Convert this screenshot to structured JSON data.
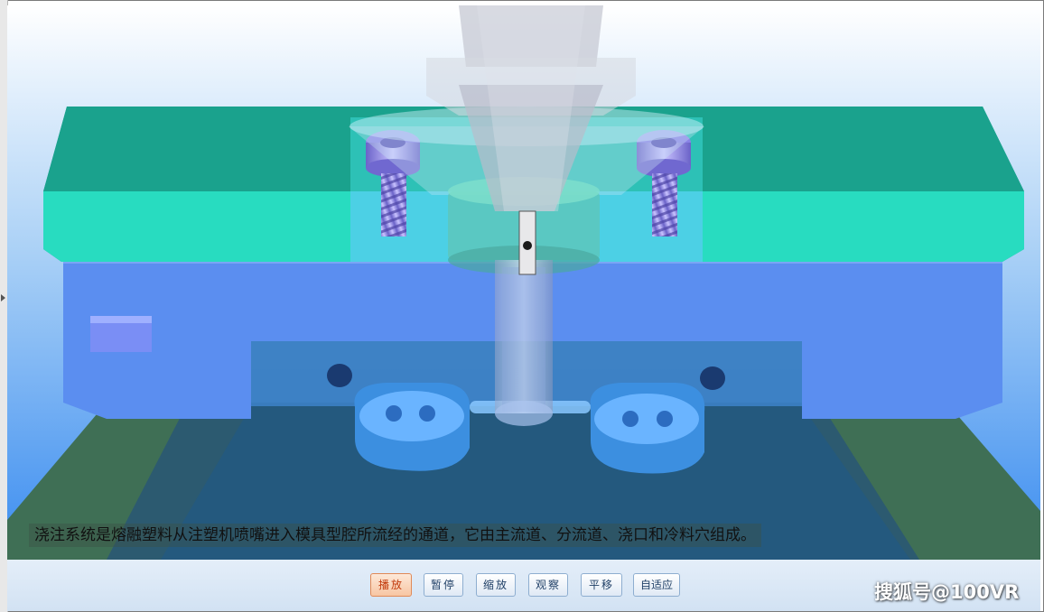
{
  "caption": "浇注系统是熔融塑料从注塑机喷嘴进入模具型腔所流经的通道，它由主流道、分流道、浇口和冷料穴组成。",
  "toolbar": {
    "buttons": [
      {
        "label": "播放",
        "active": true
      },
      {
        "label": "暂停",
        "active": false
      },
      {
        "label": "缩放",
        "active": false
      },
      {
        "label": "观察",
        "active": false
      },
      {
        "label": "平移",
        "active": false
      },
      {
        "label": "自适应",
        "active": false
      }
    ]
  },
  "watermark": "搜狐号@100VR",
  "colors": {
    "sky_top": "#ffffff",
    "sky_bottom": "#3e8ff0",
    "top_plate": "#24d8bd",
    "top_plate_face": "#1a9a86",
    "mid_plate": "#5b8ef0",
    "lower_plate": "#2f6fb4",
    "base_plate": "#3f6f55",
    "button_active": "#f7c6a3"
  },
  "icons": {
    "left_collapse": "left-arrow-icon"
  }
}
